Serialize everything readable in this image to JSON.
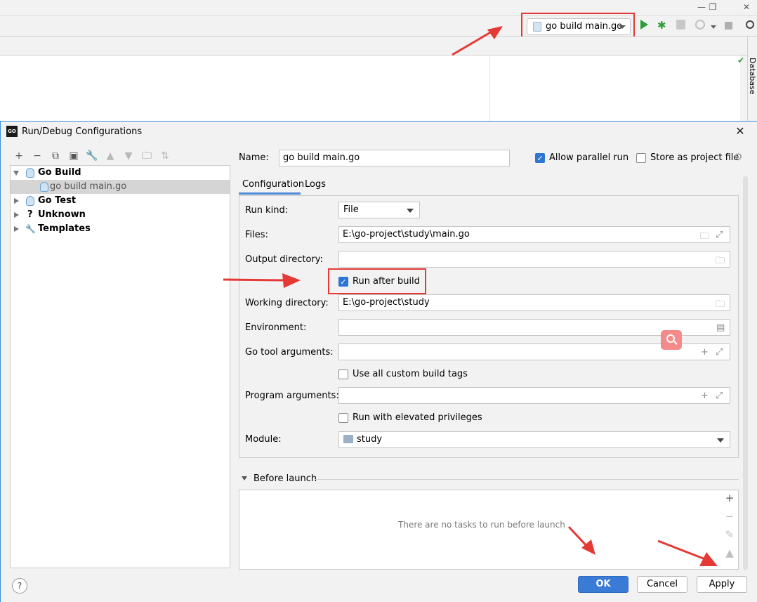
{
  "ide": {
    "run_config_name": "go build main.go",
    "sidebar_tab": "Database"
  },
  "dialog": {
    "title": "Run/Debug Configurations",
    "logo_text": "GO",
    "tree": [
      {
        "label": "Go Build",
        "bold": true
      },
      {
        "label": "go build main.go",
        "bold": false
      },
      {
        "label": "Go Test",
        "bold": true
      },
      {
        "label": "Unknown",
        "bold": true
      },
      {
        "label": "Templates",
        "bold": true
      }
    ],
    "name_label": "Name:",
    "name_value": "go build main.go",
    "allow_parallel_label": "Allow parallel run",
    "allow_parallel_checked": true,
    "store_project_label": "Store as project file",
    "store_project_checked": false,
    "tabs": [
      "Configuration",
      "Logs"
    ],
    "fields": {
      "run_kind_label": "Run kind:",
      "run_kind_value": "File",
      "files_label": "Files:",
      "files_value": "E:\\go-project\\study\\main.go",
      "output_dir_label": "Output directory:",
      "output_dir_value": "",
      "run_after_build_label": "Run after build",
      "run_after_build_checked": true,
      "working_dir_label": "Working directory:",
      "working_dir_value": "E:\\go-project\\study",
      "environment_label": "Environment:",
      "environment_value": "",
      "go_tool_args_label": "Go tool arguments:",
      "go_tool_args_value": "",
      "custom_tags_label": "Use all custom build tags",
      "custom_tags_checked": false,
      "program_args_label": "Program arguments:",
      "program_args_value": "",
      "elevated_label": "Run with elevated privileges",
      "elevated_checked": false,
      "module_label": "Module:",
      "module_value": "study"
    },
    "before_launch_label": "Before launch",
    "before_launch_empty": "There are no tasks to run before launch",
    "buttons": {
      "ok": "OK",
      "cancel": "Cancel",
      "apply": "Apply"
    },
    "help": "?"
  },
  "colors": {
    "annotation_red": "#e53935",
    "primary_blue": "#3a7bd5",
    "run_green": "#2e9e3c"
  }
}
